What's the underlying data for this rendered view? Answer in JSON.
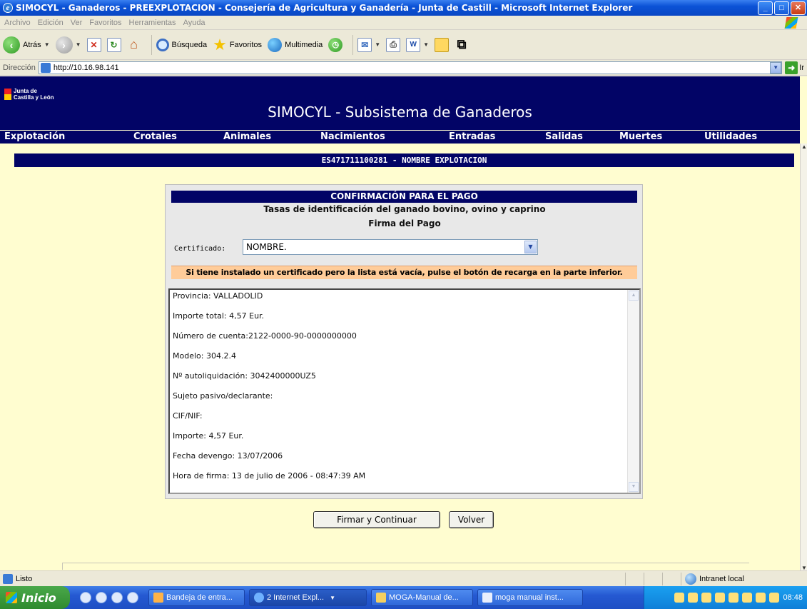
{
  "window": {
    "title": "SIMOCYL - Ganaderos - PREEXPLOTACION - Consejería de Agricultura y Ganadería - Junta de Castill - Microsoft Internet Explorer"
  },
  "menubar": {
    "items": [
      "Archivo",
      "Edición",
      "Ver",
      "Favoritos",
      "Herramientas",
      "Ayuda"
    ]
  },
  "toolbar": {
    "back_label": "Atrás",
    "search_label": "Búsqueda",
    "favorites_label": "Favoritos",
    "media_label": "Multimedia"
  },
  "addressbar": {
    "label": "Dirección",
    "url": "http://10.16.98.141",
    "go_label": "Ir"
  },
  "site": {
    "logo_line1": "Junta de",
    "logo_line2": "Castilla y León",
    "title": "SIMOCYL - Subsistema de Ganaderos",
    "nav": [
      "Explotación",
      "Crotales",
      "Animales",
      "Nacimientos",
      "Entradas",
      "Salidas",
      "Muertes",
      "Utilidades"
    ],
    "farm_bar": "ES471711100281 - NOMBRE EXPLOTACION"
  },
  "panel": {
    "header": "CONFIRMACIÓN PARA EL PAGO",
    "subtitle1": "Tasas de identificación del ganado bovino, ovino y caprino",
    "subtitle2": "Firma del Pago",
    "cert_label": "Certificado:",
    "cert_value": "NOMBRE.",
    "warning": "Si tiene instalado un certificado pero la lista está vacía, pulse el botón de recarga en la parte inferior.",
    "details": [
      "Provincia: VALLADOLID",
      "Importe total: 4,57 Eur.",
      "Número de cuenta:2122-0000-90-0000000000",
      "Modelo: 304.2.4",
      "Nº autoliquidación: 3042400000UZ5",
      "Sujeto pasivo/declarante:",
      "CIF/NIF:",
      "Importe: 4,57 Eur.",
      "Fecha devengo: 13/07/2006",
      "Hora de firma: 13 de julio de 2006 - 08:47:39 AM"
    ],
    "sign_button": "Firmar y Continuar",
    "back_button": "Volver"
  },
  "statusbar": {
    "status": "Listo",
    "zone": "Intranet local"
  },
  "taskbar": {
    "start_label": "Inicio",
    "tasks": [
      "Bandeja de entra...",
      "2 Internet Expl...",
      "MOGA-Manual de...",
      "moga manual inst..."
    ],
    "clock": "08:48"
  }
}
